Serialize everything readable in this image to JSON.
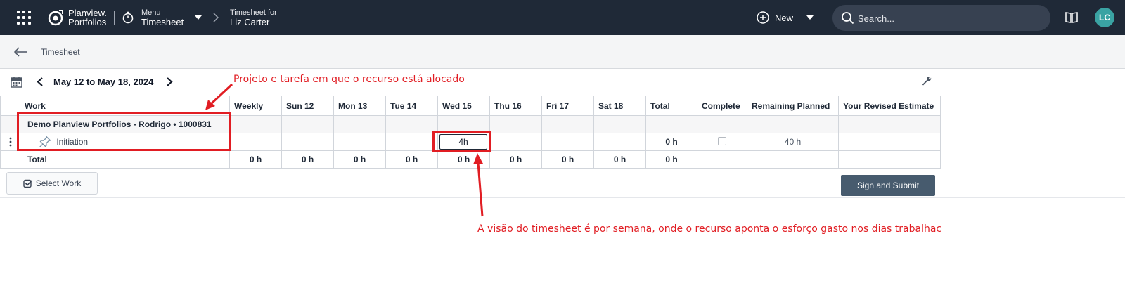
{
  "topbar": {
    "brand_line1": "Planview.",
    "brand_line2": "Portfolios",
    "menu_small": "Menu",
    "menu_big": "Timesheet",
    "ts_small": "Timesheet for",
    "ts_big": "Liz Carter",
    "new_label": "New",
    "search_placeholder": "Search...",
    "avatar_initials": "LC"
  },
  "subheader": {
    "title": "Timesheet"
  },
  "toolbar": {
    "date_range": "May 12 to May 18, 2024"
  },
  "table": {
    "headers": [
      "Work",
      "Weekly",
      "Sun 12",
      "Mon 13",
      "Tue 14",
      "Wed 15",
      "Thu 16",
      "Fri 17",
      "Sat 18",
      "Total",
      "Complete",
      "Remaining Planned",
      "Your Revised Estimate"
    ],
    "group": "Demo Planview Portfolios - Rodrigo • 1000831",
    "task": {
      "name": "Initiation",
      "wed_value": "4h",
      "total": "0 h",
      "remaining": "40 h"
    },
    "total_row": {
      "label": "Total",
      "values": [
        "0 h",
        "0 h",
        "0 h",
        "0 h",
        "0 h",
        "0 h",
        "0 h",
        "0 h",
        "0 h"
      ]
    }
  },
  "actions": {
    "select_work": "Select Work",
    "sign_submit": "Sign and Submit"
  },
  "annotations": {
    "top": "Projeto e tarefa em que o recurso está alocado",
    "bottom": "A visão do timesheet é por semana, onde o recurso aponta o esforço gasto nos dias trabalhac",
    "color": "#e11d23"
  }
}
